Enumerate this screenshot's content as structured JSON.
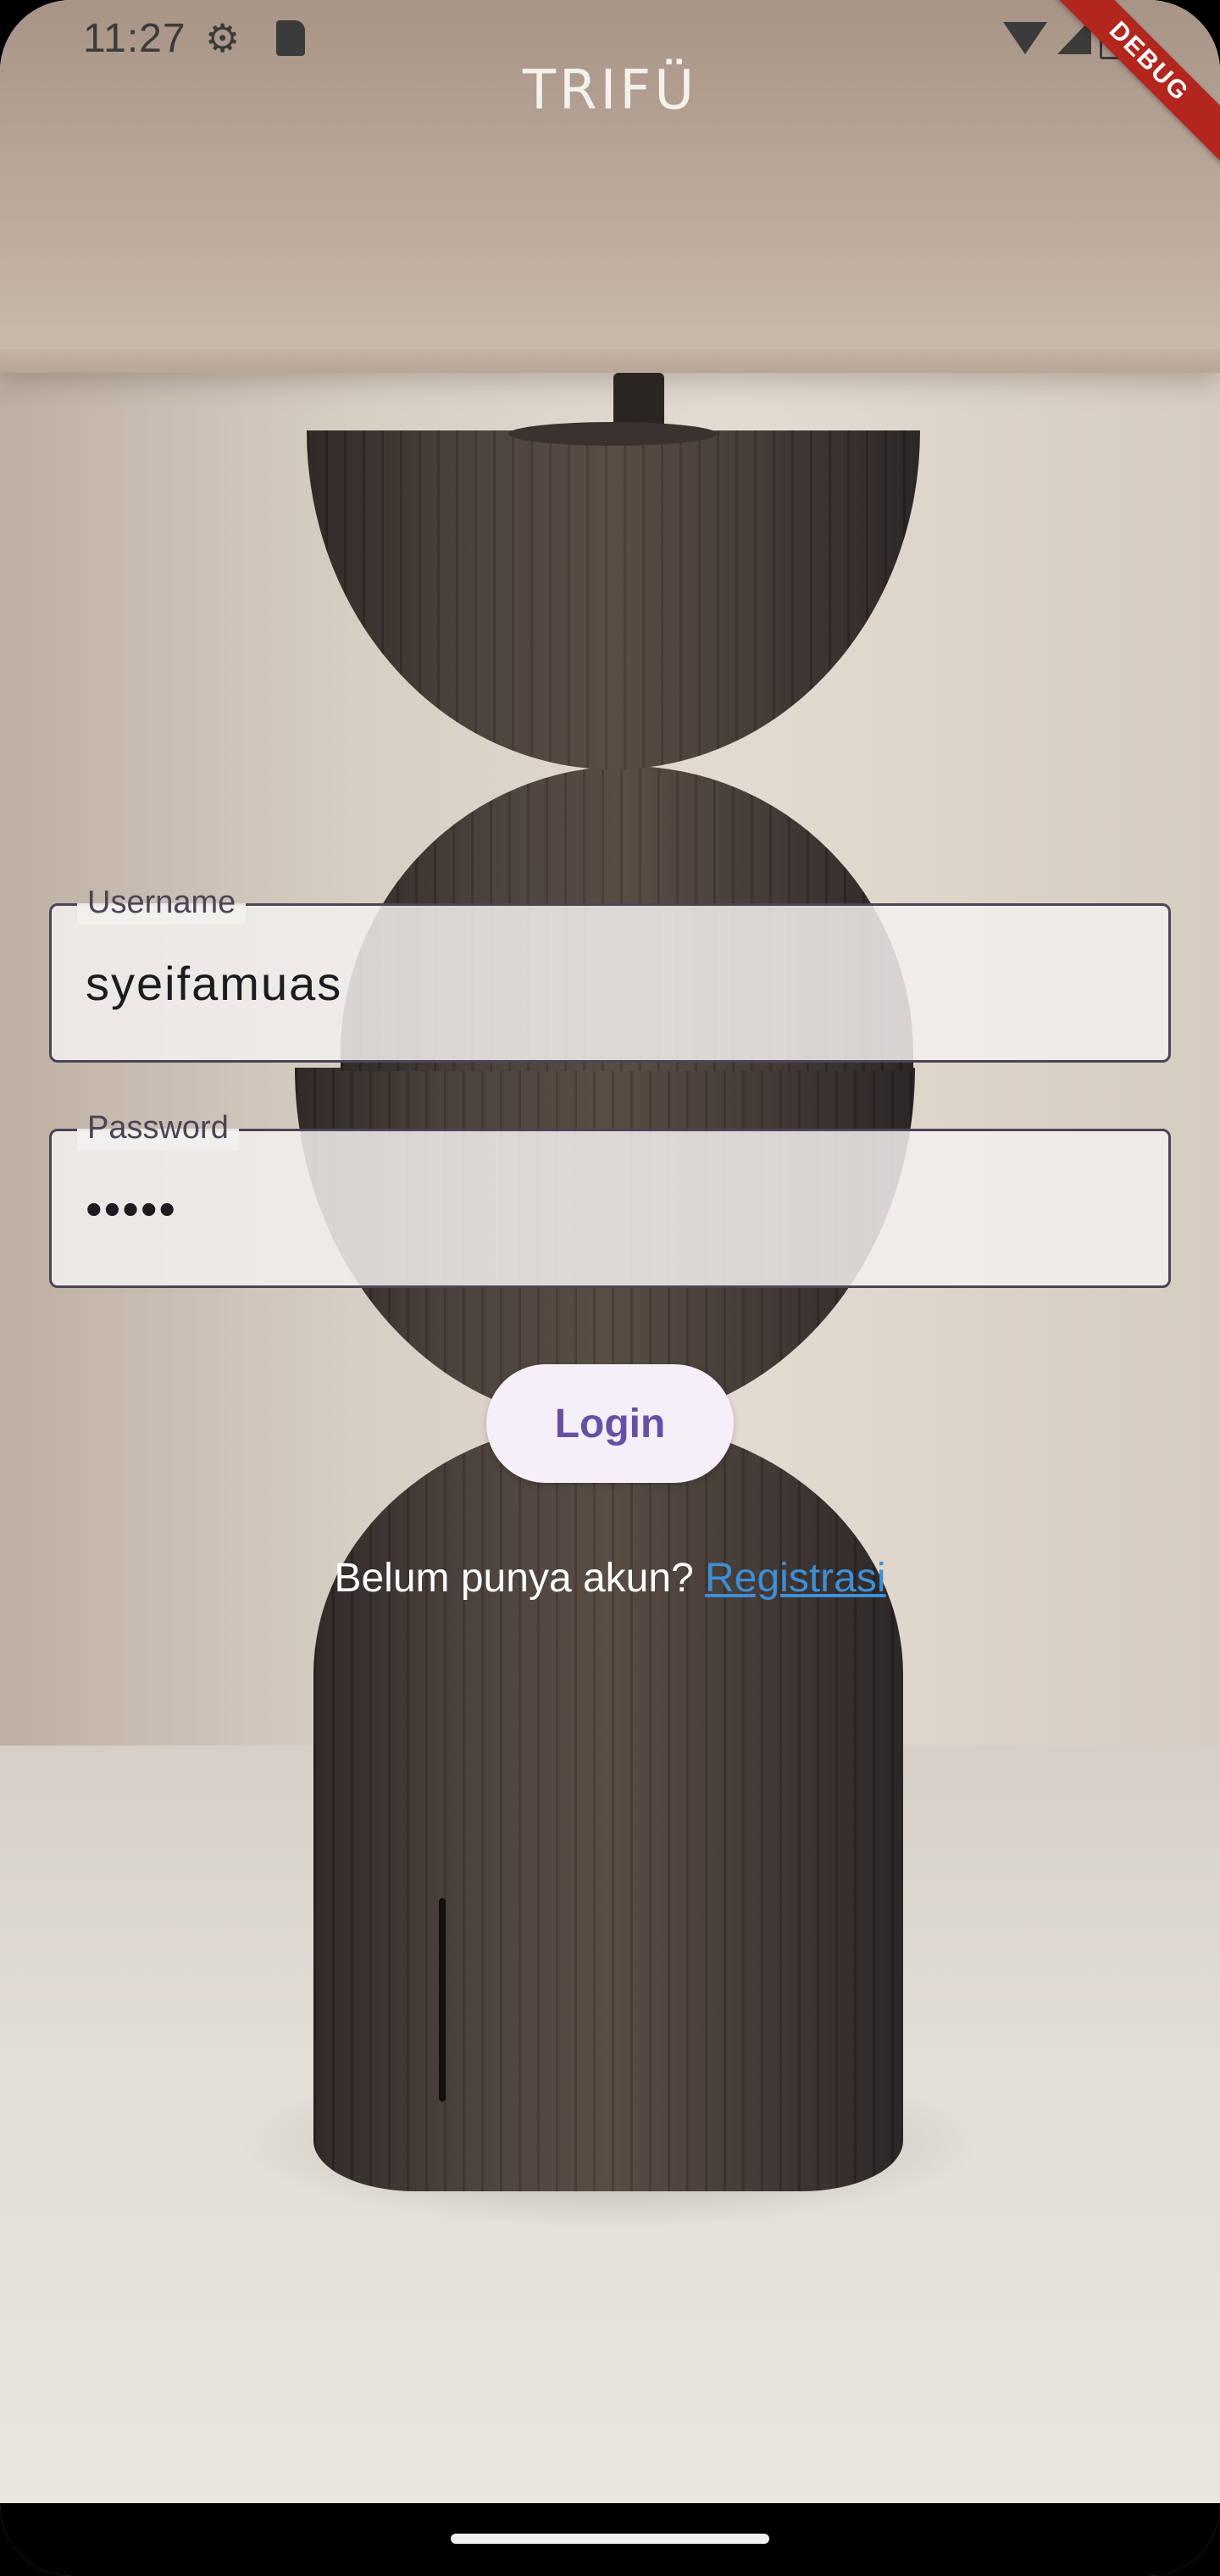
{
  "status_bar": {
    "time": "11:27",
    "icons": [
      "gear-icon",
      "sd-card-icon",
      "wifi-icon",
      "cell-signal-icon",
      "battery-icon"
    ]
  },
  "debug_banner": {
    "label": "DEBUG",
    "color": "#b3261e"
  },
  "app": {
    "title": "TRIFÜ"
  },
  "form": {
    "username": {
      "label": "Username",
      "value": "syeifamuas"
    },
    "password": {
      "label": "Password",
      "value": "•••••"
    },
    "login_label": "Login"
  },
  "register": {
    "prompt": "Belum punya akun?",
    "link_label": "Registrasi"
  },
  "colors": {
    "primary": "#6750a4",
    "button_bg": "#f4eff8",
    "link": "#3d8fd6",
    "field_border": "#4a4556"
  }
}
